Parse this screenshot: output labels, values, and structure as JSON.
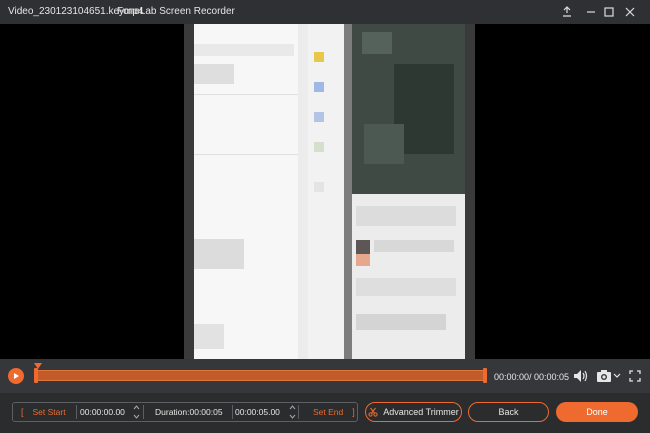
{
  "window": {
    "file_name": "Video_230123104651.keymp4",
    "app_name": "FoneLab Screen Recorder"
  },
  "window_controls": {
    "pin_icon": "pin-icon",
    "minimize_icon": "minimize-icon",
    "maximize_icon": "maximize-icon",
    "close_icon": "close-icon"
  },
  "playback": {
    "progress": 0.0,
    "time_readout": "00:00:00/ 00:00:05"
  },
  "trim": {
    "set_start_label": "Set Start",
    "start_value": "00:00:00.00",
    "duration_label": "Duration:00:00:05",
    "end_value": "00:00:05.00",
    "set_end_label": "Set End"
  },
  "buttons": {
    "advanced_trimmer": "Advanced Trimmer",
    "back": "Back",
    "done": "Done"
  },
  "colors": {
    "accent": "#ee6a2e",
    "background": "#2b2c2e",
    "titlebar": "#2f3033"
  }
}
